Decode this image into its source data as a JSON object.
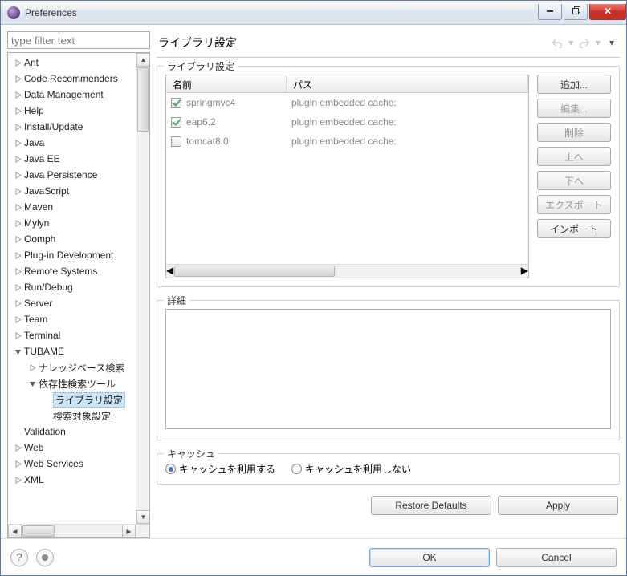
{
  "window": {
    "title": "Preferences"
  },
  "filter": {
    "placeholder": "type filter text"
  },
  "tree": [
    {
      "label": "Ant",
      "depth": 0,
      "expandable": true,
      "expanded": false
    },
    {
      "label": "Code Recommenders",
      "depth": 0,
      "expandable": true,
      "expanded": false
    },
    {
      "label": "Data Management",
      "depth": 0,
      "expandable": true,
      "expanded": false
    },
    {
      "label": "Help",
      "depth": 0,
      "expandable": true,
      "expanded": false
    },
    {
      "label": "Install/Update",
      "depth": 0,
      "expandable": true,
      "expanded": false
    },
    {
      "label": "Java",
      "depth": 0,
      "expandable": true,
      "expanded": false
    },
    {
      "label": "Java EE",
      "depth": 0,
      "expandable": true,
      "expanded": false
    },
    {
      "label": "Java Persistence",
      "depth": 0,
      "expandable": true,
      "expanded": false
    },
    {
      "label": "JavaScript",
      "depth": 0,
      "expandable": true,
      "expanded": false
    },
    {
      "label": "Maven",
      "depth": 0,
      "expandable": true,
      "expanded": false
    },
    {
      "label": "Mylyn",
      "depth": 0,
      "expandable": true,
      "expanded": false
    },
    {
      "label": "Oomph",
      "depth": 0,
      "expandable": true,
      "expanded": false
    },
    {
      "label": "Plug-in Development",
      "depth": 0,
      "expandable": true,
      "expanded": false
    },
    {
      "label": "Remote Systems",
      "depth": 0,
      "expandable": true,
      "expanded": false
    },
    {
      "label": "Run/Debug",
      "depth": 0,
      "expandable": true,
      "expanded": false
    },
    {
      "label": "Server",
      "depth": 0,
      "expandable": true,
      "expanded": false
    },
    {
      "label": "Team",
      "depth": 0,
      "expandable": true,
      "expanded": false
    },
    {
      "label": "Terminal",
      "depth": 0,
      "expandable": true,
      "expanded": false
    },
    {
      "label": "TUBAME",
      "depth": 0,
      "expandable": true,
      "expanded": true
    },
    {
      "label": "ナレッジベース検索",
      "depth": 1,
      "expandable": true,
      "expanded": false
    },
    {
      "label": "依存性検索ツール",
      "depth": 1,
      "expandable": true,
      "expanded": true
    },
    {
      "label": "ライブラリ設定",
      "depth": 2,
      "expandable": false,
      "selected": true
    },
    {
      "label": "検索対象設定",
      "depth": 2,
      "expandable": false
    },
    {
      "label": "Validation",
      "depth": 0,
      "expandable": false
    },
    {
      "label": "Web",
      "depth": 0,
      "expandable": true,
      "expanded": false
    },
    {
      "label": "Web Services",
      "depth": 0,
      "expandable": true,
      "expanded": false
    },
    {
      "label": "XML",
      "depth": 0,
      "expandable": true,
      "expanded": false
    }
  ],
  "page": {
    "title": "ライブラリ設定",
    "group_label": "ライブラリ設定",
    "columns": {
      "name": "名前",
      "path": "パス"
    },
    "rows": [
      {
        "checked": true,
        "name": "springmvc4",
        "path": "plugin embedded cache:"
      },
      {
        "checked": true,
        "name": "eap6.2",
        "path": "plugin embedded cache:"
      },
      {
        "checked": false,
        "name": "tomcat8.0",
        "path": "plugin embedded cache:"
      }
    ],
    "buttons": {
      "add": "追加...",
      "edit": "編集...",
      "delete": "削除",
      "up": "上へ",
      "down": "下へ",
      "export": "エクスポート",
      "import": "インポート"
    },
    "detail_label": "詳細",
    "cache": {
      "label": "キャッシュ",
      "use": "キャッシュを利用する",
      "nouse": "キャッシュを利用しない",
      "selected": "use"
    },
    "restore": "Restore Defaults",
    "apply": "Apply"
  },
  "footer": {
    "ok": "OK",
    "cancel": "Cancel"
  }
}
